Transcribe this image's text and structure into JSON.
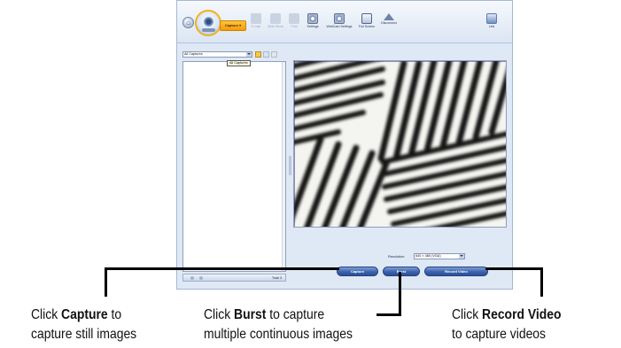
{
  "toolbar": {
    "home_glyph": "⌂",
    "capture_menu": "Capture ▾",
    "buttons": [
      {
        "label": "E-mail",
        "icon": "email-icon",
        "enabled": false
      },
      {
        "label": "Slide Show",
        "icon": "slideshow-icon",
        "enabled": false
      },
      {
        "label": "Print",
        "icon": "print-icon",
        "enabled": false
      },
      {
        "label": "Settings",
        "icon": "settings-icon",
        "enabled": true
      },
      {
        "label": "WebCam Settings",
        "icon": "webcam-settings-icon",
        "enabled": true
      },
      {
        "label": "Full Screen",
        "icon": "fullscreen-icon",
        "enabled": true
      },
      {
        "label": "Disconnect",
        "icon": "disconnect-icon",
        "enabled": true
      }
    ],
    "link_label": "Link"
  },
  "gallery": {
    "filter_value": "All Captures",
    "tooltip": "All Captures",
    "status_total": "Total 3"
  },
  "preview": {
    "resolution_label": "Resolution:",
    "resolution_value": "640 × 480 (VGA)"
  },
  "actions": {
    "capture": "Capture",
    "burst": "Burst",
    "record_video": "Record Video"
  },
  "captions": {
    "capture": {
      "pre": "Click ",
      "bold": "Capture",
      "post": " to",
      "line2": "capture still images"
    },
    "burst": {
      "pre": "Click ",
      "bold": "Burst",
      "post": " to capture",
      "line2": "multiple continuous images"
    },
    "record": {
      "pre": "Click ",
      "bold": "Record Video",
      "line2": "to capture videos"
    }
  },
  "colors": {
    "accent_orange": "#f5a623",
    "button_blue": "#3b62ad",
    "window_bg": "#dfe8f5"
  }
}
